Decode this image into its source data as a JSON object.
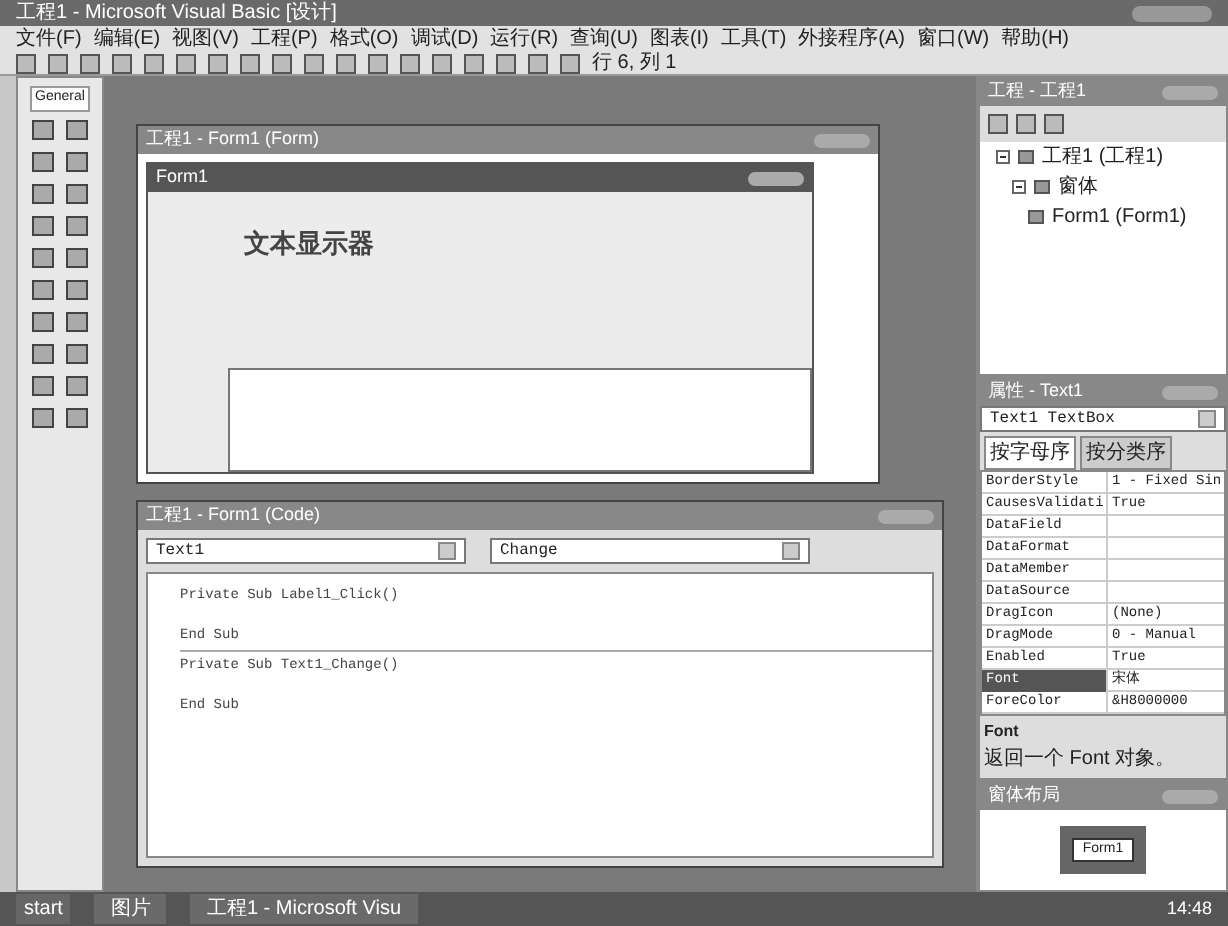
{
  "window": {
    "title": "工程1 - Microsoft Visual Basic [设计]"
  },
  "menu": [
    "文件(F)",
    "编辑(E)",
    "视图(V)",
    "工程(P)",
    "格式(O)",
    "调试(D)",
    "运行(R)",
    "查询(U)",
    "图表(I)",
    "工具(T)",
    "外接程序(A)",
    "窗口(W)",
    "帮助(H)"
  ],
  "toolbar": {
    "position": "行 6, 列 1"
  },
  "toolbox": {
    "tab": "General"
  },
  "designer": {
    "title": "工程1 - Form1 (Form)",
    "form_title": "Form1",
    "label": "文本显示器"
  },
  "code_window": {
    "title": "工程1 - Form1 (Code)",
    "object": "Text1",
    "procedure": "Change",
    "procedures": [
      {
        "header": "Private Sub Label1_Click()",
        "footer": "End Sub"
      },
      {
        "header": "Private Sub Text1_Change()",
        "footer": "End Sub"
      }
    ]
  },
  "project": {
    "title": "工程 - 工程1",
    "tree": [
      {
        "label": "工程1 (工程1)",
        "expanded": true,
        "children": [
          {
            "label": "窗体",
            "expanded": true,
            "children": [
              {
                "label": "Form1 (Form1)"
              }
            ]
          }
        ]
      }
    ]
  },
  "properties": {
    "title": "属性 - Text1",
    "object": "Text1 TextBox",
    "tabs": [
      {
        "label": "按字母序",
        "selected": true
      },
      {
        "label": "按分类序",
        "selected": false
      }
    ],
    "rows": [
      {
        "name": "BorderStyle",
        "value": "1 - Fixed Sin",
        "selected": false
      },
      {
        "name": "CausesValidati",
        "value": "True",
        "selected": false
      },
      {
        "name": "DataField",
        "selected": false
      },
      {
        "name": "DataFormat",
        "selected": false
      },
      {
        "name": "DataMember",
        "selected": false
      },
      {
        "name": "DataSource",
        "selected": false
      },
      {
        "name": "DragIcon",
        "value": "(None)",
        "selected": false
      },
      {
        "name": "DragMode",
        "value": "0 - Manual",
        "selected": false
      },
      {
        "name": "Enabled",
        "value": "True",
        "selected": false
      },
      {
        "name": "Font",
        "value": "宋体",
        "selected": true
      },
      {
        "name": "ForeColor",
        "value": "&H8000000",
        "selected": false
      }
    ],
    "desc_title": "Font",
    "desc": "返回一个 Font 对象。"
  },
  "layout_window": {
    "title": "窗体布局",
    "form": "Form1"
  },
  "taskbar": {
    "start": "start",
    "items": [
      "图片",
      "工程1 - Microsoft Visu"
    ],
    "clock": "14:48"
  }
}
